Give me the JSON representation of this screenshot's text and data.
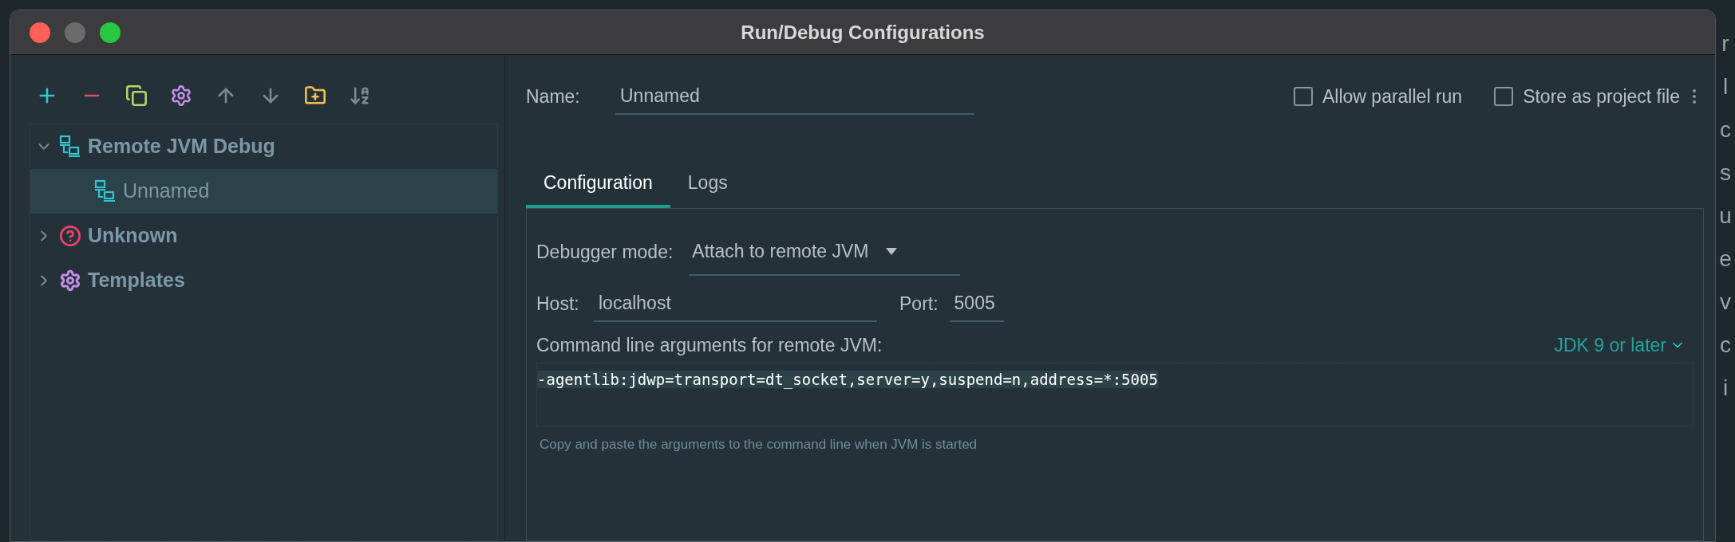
{
  "window": {
    "title": "Run/Debug Configurations"
  },
  "tree": [
    {
      "label": "Remote JVM Debug",
      "expanded": true,
      "selected": false,
      "children": [
        {
          "label": "Unnamed",
          "selected": true
        }
      ]
    },
    {
      "label": "Unknown",
      "expanded": false,
      "selected": false
    },
    {
      "label": "Templates",
      "expanded": false,
      "selected": false
    }
  ],
  "name": {
    "label": "Name:",
    "value": "Unnamed"
  },
  "options": [
    {
      "label": "Allow parallel run",
      "checked": false
    },
    {
      "label": "Store as project file",
      "checked": false
    }
  ],
  "tabs": [
    {
      "label": "Configuration",
      "selected": true
    },
    {
      "label": "Logs",
      "selected": false
    }
  ],
  "debugger_mode": {
    "label": "Debugger mode:",
    "value": "Attach to remote JVM"
  },
  "host": {
    "label": "Host:",
    "value": "localhost"
  },
  "port": {
    "label": "Port:",
    "value": "5005"
  },
  "arguments": {
    "label": "Command line arguments for remote JVM:",
    "jdk_link": "JDK 9 or later",
    "value": "-agentlib:jdwp=transport=dt_socket,server=y,suspend=n,address=*:5005",
    "hint": "Copy and paste the arguments to the command line when JVM is started"
  },
  "background_letters": [
    "r",
    "l",
    "c",
    "s",
    "u",
    "e",
    "v",
    "c",
    "i"
  ]
}
